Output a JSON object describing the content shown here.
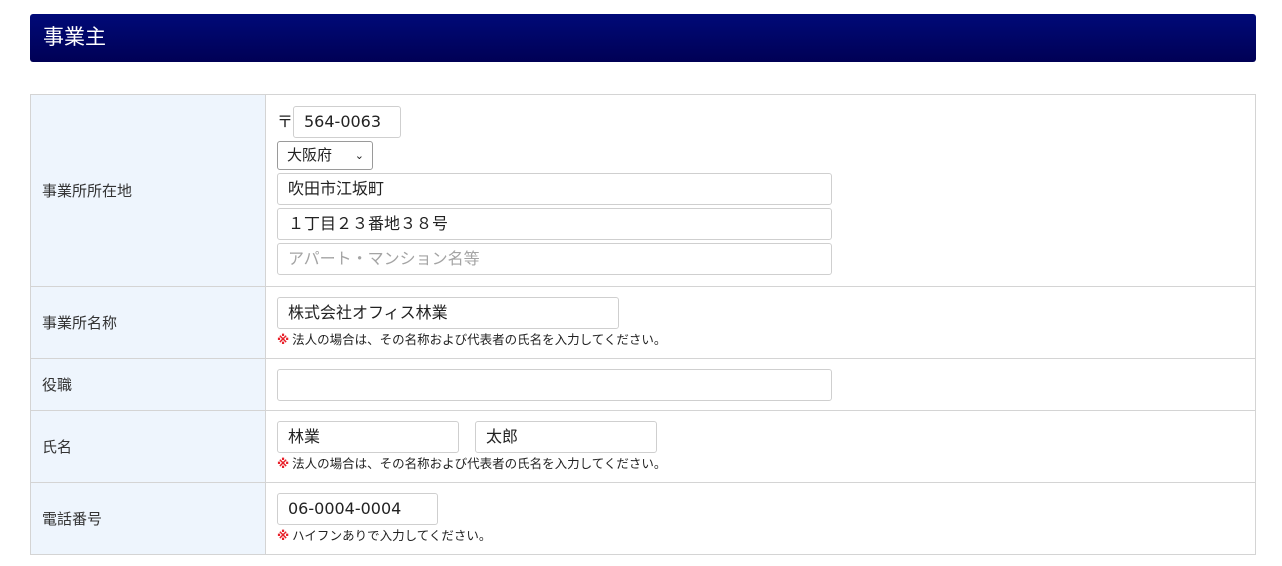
{
  "section": {
    "title": "事業主"
  },
  "address": {
    "label": "事業所所在地",
    "postal_mark": "〒",
    "postal_code": "564-0063",
    "prefecture": "大阪府",
    "city": "吹田市江坂町",
    "street": "１丁目２３番地３８号",
    "building_placeholder": "アパート・マンション名等"
  },
  "office_name": {
    "label": "事業所名称",
    "value": "株式会社オフィス林業",
    "note_mark": "※",
    "note": "法人の場合は、その名称および代表者の氏名を入力してください。"
  },
  "position": {
    "label": "役職",
    "value": ""
  },
  "name": {
    "label": "氏名",
    "last": "林業",
    "first": "太郎",
    "note_mark": "※",
    "note": "法人の場合は、その名称および代表者の氏名を入力してください。"
  },
  "phone": {
    "label": "電話番号",
    "value": "06-0004-0004",
    "note_mark": "※",
    "note": "ハイフンありで入力してください。"
  },
  "icons": {
    "dropdown": "chevron-down-icon",
    "note_mark_color": "#e8202a"
  }
}
